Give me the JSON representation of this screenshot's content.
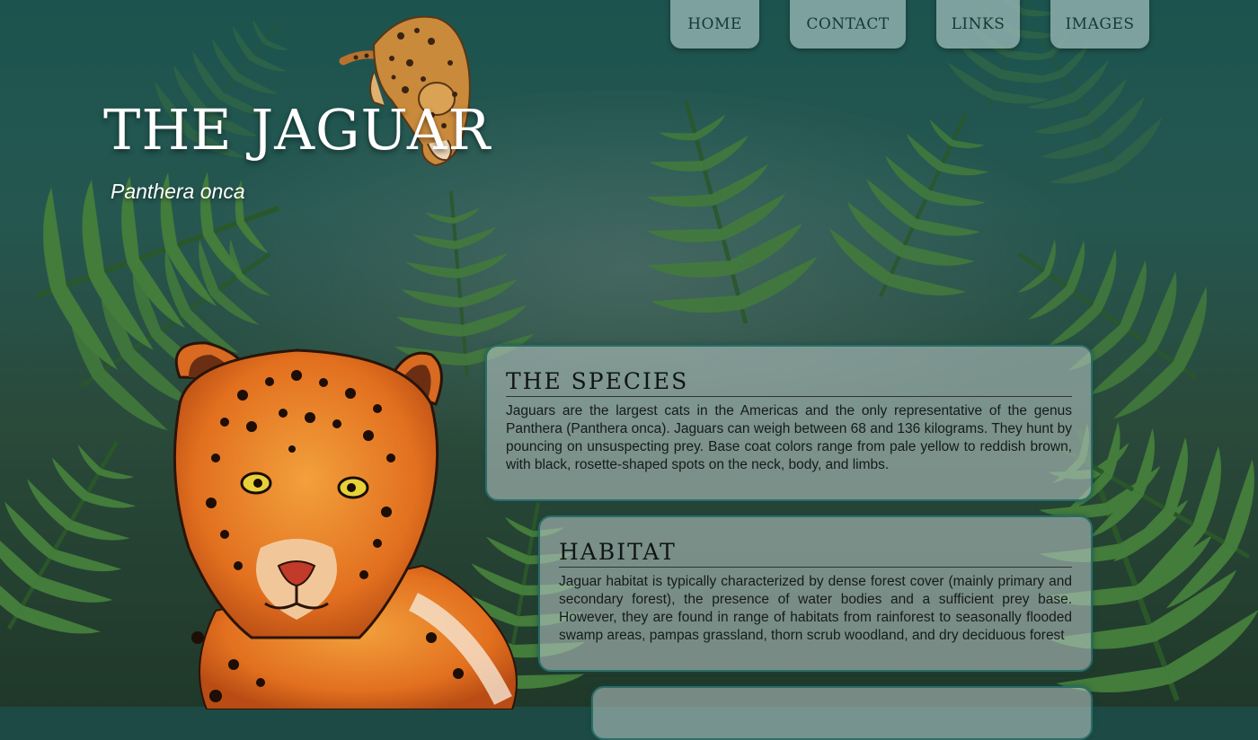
{
  "nav": {
    "items": [
      {
        "label": "HOME"
      },
      {
        "label": "CONTACT"
      },
      {
        "label": "LINKS"
      },
      {
        "label": "IMAGES"
      }
    ]
  },
  "header": {
    "title": "THE JAGUAR",
    "subtitle": "Panthera onca"
  },
  "sections": [
    {
      "heading": "THE SPECIES",
      "body": "Jaguars are the largest cats in the Americas and the only representative of the genus Panthera (Panthera onca). Jaguars can weigh between 68 and 136 kilograms. They hunt by pouncing on unsuspecting prey. Base coat colors range from pale yellow to reddish brown, with black, rosette-shaped spots on the neck, body, and limbs."
    },
    {
      "heading": "HABITAT",
      "body": "Jaguar habitat is typically characterized by dense forest cover (mainly primary and secondary forest), the presence of water bodies and a sufficient prey base. However, they are found in range of habitats from rainforest to seasonally flooded swamp areas, pampas grassland, thorn scrub woodland, and dry deciduous forest"
    }
  ],
  "images": {
    "background": "jungle-fern-background",
    "small_illustration": "jaguar-climbing-illustration",
    "large_illustration": "jaguar-portrait-illustration"
  },
  "colors": {
    "nav_bg": "#92b2b0",
    "panel_bg": "#b9c8c6",
    "panel_border": "#2b6d67",
    "title": "#ffffff",
    "fern": "#3f7a3a"
  }
}
